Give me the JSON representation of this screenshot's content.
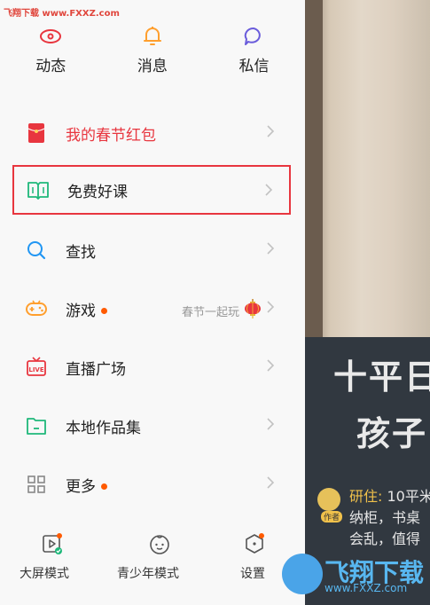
{
  "watermark": "飞翔下载 www.FXXZ.com",
  "topnav": [
    {
      "label": "动态",
      "icon": "eye-icon"
    },
    {
      "label": "消息",
      "icon": "bell-icon"
    },
    {
      "label": "私信",
      "icon": "chat-icon"
    }
  ],
  "menu": {
    "redpacket": "我的春节红包",
    "freecourse": "免费好课",
    "search": "查找",
    "game": "游戏",
    "game_hint": "春节一起玩",
    "live": "直播广场",
    "local": "本地作品集",
    "more": "更多"
  },
  "bottom": {
    "bigscreen": "大屏模式",
    "teen": "青少年模式",
    "settings": "设置"
  },
  "video": {
    "caption_line1": "十平日",
    "caption_line2": "孩子",
    "comment_author": "研住:",
    "comment_line1": " 10平米",
    "comment_line2": "纳柜，书桌",
    "comment_line3": "会乱，值得",
    "author_badge": "作者"
  },
  "logo": {
    "name": "飞翔下载",
    "url": "www.FXXZ.com"
  },
  "colors": {
    "accent": "#e8363f",
    "orange": "#ff9f2e",
    "blue": "#2196f3",
    "green": "#1fb87a",
    "purple": "#6a5cdb"
  }
}
